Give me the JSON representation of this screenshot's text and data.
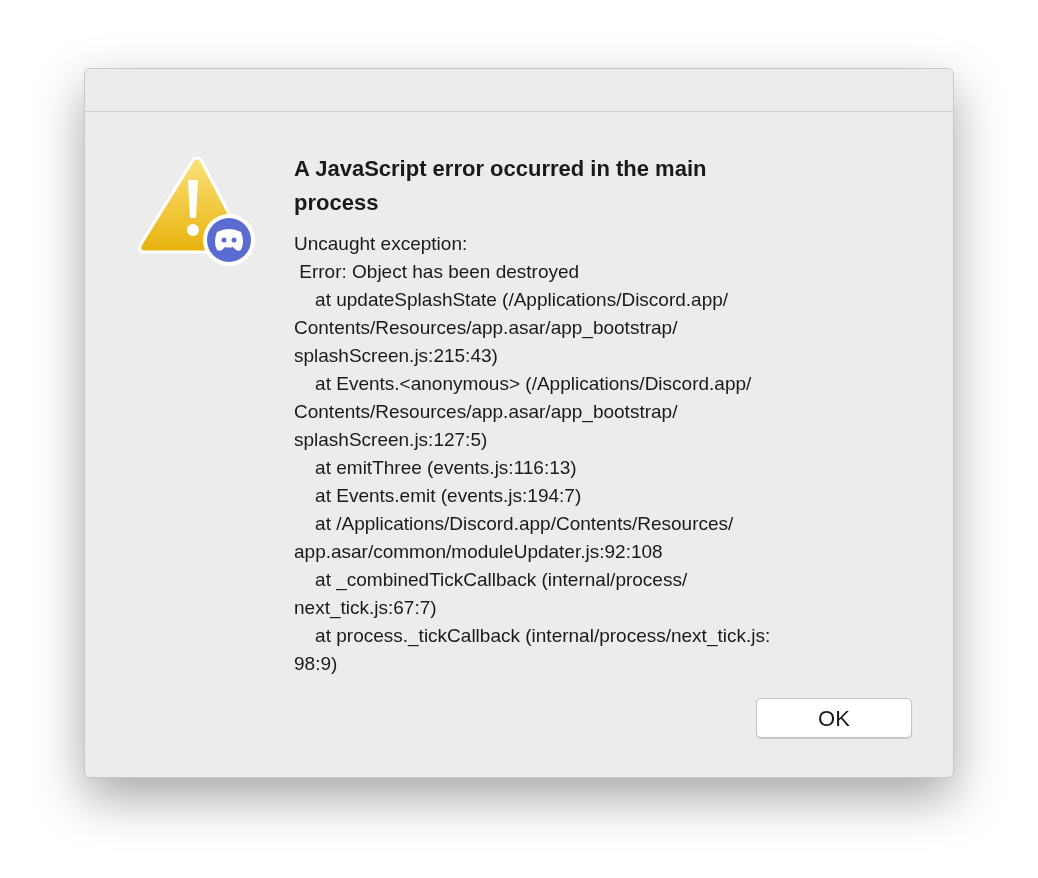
{
  "dialog": {
    "title": "A JavaScript error occurred in the main process",
    "message_lines": [
      "Uncaught exception:",
      " Error: Object has been destroyed",
      "    at updateSplashState (/Applications/Discord.app/",
      "Contents/Resources/app.asar/app_bootstrap/",
      "splashScreen.js:215:43)",
      "    at Events.<anonymous> (/Applications/Discord.app/",
      "Contents/Resources/app.asar/app_bootstrap/",
      "splashScreen.js:127:5)",
      "    at emitThree (events.js:116:13)",
      "    at Events.emit (events.js:194:7)",
      "    at /Applications/Discord.app/Contents/Resources/",
      "app.asar/common/moduleUpdater.js:92:108",
      "    at _combinedTickCallback (internal/process/",
      "next_tick.js:67:7)",
      "    at process._tickCallback (internal/process/next_tick.js:",
      "98:9)"
    ],
    "buttons": [
      "OK"
    ]
  }
}
